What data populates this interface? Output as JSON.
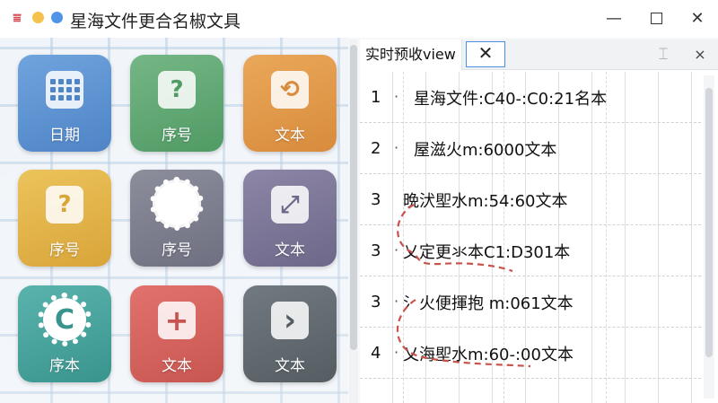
{
  "window": {
    "title": "星海文件更合名椒文具",
    "logo_glyph": "⩸",
    "controls": {
      "minimize": "—",
      "close": "✕"
    },
    "colors": {
      "logo": "#d9484f",
      "dot_yellow": "#f4c24d",
      "dot_blue": "#4f94e6"
    }
  },
  "tiles": [
    {
      "label": "日期",
      "icon": "calendar-icon",
      "color": "#5f94d4"
    },
    {
      "label": "序号",
      "icon": "question-icon",
      "glyph": "?",
      "color": "#62a875"
    },
    {
      "label": "文本",
      "icon": "loop-icon",
      "glyph": "⟲",
      "color": "#e09a4b"
    },
    {
      "label": "序号",
      "icon": "question-icon",
      "glyph": "?",
      "color": "#e2b44a"
    },
    {
      "label": "序号",
      "icon": "gear-icon",
      "color": "#7e7f8e"
    },
    {
      "label": "文本",
      "icon": "expand-arrows-icon",
      "glyph": "⤢",
      "color": "#7d7798"
    },
    {
      "label": "序本",
      "icon": "gear-c-icon",
      "glyph": "C",
      "color": "#4aa49e"
    },
    {
      "label": "文本",
      "icon": "plus-icon",
      "glyph": "+",
      "color": "#d5635e"
    },
    {
      "label": "文本",
      "icon": "chevron-right-icon",
      "glyph": "›",
      "color": "#636b71"
    }
  ],
  "preview": {
    "tab_label": "实时预收view",
    "tab_close": "✕",
    "tab_extra": "⌶",
    "panel_close": "×",
    "rows": [
      {
        "num": "1",
        "dot": "·",
        "text": "星海文件:C40-:C0:21名本"
      },
      {
        "num": "2",
        "dot": "·",
        "text": "屋滋火m:6000文本"
      },
      {
        "num": "3",
        "dot": "",
        "text": "晩汱堲水m:54:60文本"
      },
      {
        "num": "3",
        "dot": "·",
        "text": "乂定更氺本C1:D301本"
      },
      {
        "num": "3",
        "dot": "·",
        "text": "氵火便揮抱 m:061文本"
      },
      {
        "num": "4",
        "dot": "·",
        "text": "乂海堲水m:60-:00文本"
      }
    ]
  }
}
